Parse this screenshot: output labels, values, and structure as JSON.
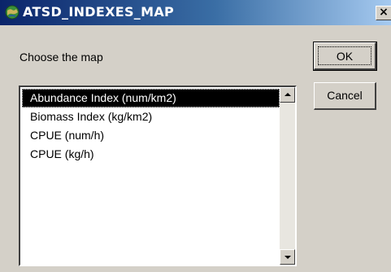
{
  "window": {
    "title": "ATSD_INDEXES_MAP",
    "icon": "globe-icon",
    "close_label": "×"
  },
  "prompt": {
    "label": "Choose the map"
  },
  "map_list": {
    "items": [
      {
        "label": "Abundance Index (num/km2)",
        "selected": true
      },
      {
        "label": "Biomass Index (kg/km2)",
        "selected": false
      },
      {
        "label": "CPUE (num/h)",
        "selected": false
      },
      {
        "label": "CPUE (kg/h)",
        "selected": false
      }
    ]
  },
  "buttons": {
    "ok_label": "OK",
    "cancel_label": "Cancel"
  },
  "colors": {
    "title_bar_start": "#0a246a",
    "title_bar_end": "#a6caf0",
    "dialog_face": "#d4d0c8",
    "selection": "#000000"
  }
}
